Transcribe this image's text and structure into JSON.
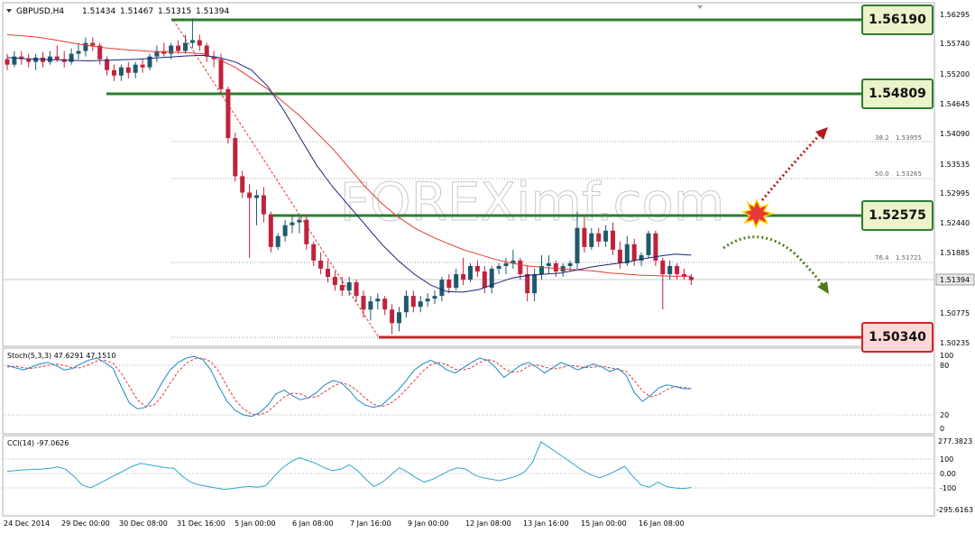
{
  "header": {
    "symbol": "GBPUSD,H4",
    "open": "1.51434",
    "high": "1.51467",
    "low": "1.51315",
    "close": "1.51394"
  },
  "watermark": "FOREXimf.com",
  "colors": {
    "background": "#ffffff",
    "bull_candle": "#1f5a6b",
    "bear_candle": "#c0223b",
    "ma_fast": "#1a237e",
    "ma_slow": "#e53935",
    "support_line": "#2e7d32",
    "target_line": "#c62828",
    "badge_green": "#eaf3c9",
    "badge_red": "#ffd7d7",
    "stoch_main": "#1e88c8",
    "stoch_signal": "#e53935",
    "cci": "#2aa7c8"
  },
  "levels": [
    {
      "value": "1.56190",
      "role": "resistance"
    },
    {
      "value": "1.54809",
      "role": "resistance"
    },
    {
      "value": "1.52575",
      "role": "resistance"
    },
    {
      "value": "1.50340",
      "role": "support"
    }
  ],
  "fibonacci": [
    {
      "ratio": "38.2",
      "price": "1.53955"
    },
    {
      "ratio": "50.0",
      "price": "1.53265"
    },
    {
      "ratio": "76.4",
      "price": "1.51721"
    }
  ],
  "price_axis": {
    "ticks": [
      "1.56295",
      "1.55740",
      "1.55200",
      "1.54645",
      "1.54090",
      "1.53535",
      "1.52995",
      "1.52440",
      "1.51885",
      "1.51394",
      "1.50775",
      "1.50235"
    ],
    "current": "1.51394"
  },
  "time_axis": [
    "24 Dec 2014",
    "29 Dec 00:00",
    "30 Dec 08:00",
    "31 Dec 16:00",
    "5 Jan 00:00",
    "6 Jan 08:00",
    "7 Jan 16:00",
    "9 Jan 00:00",
    "12 Jan 08:00",
    "13 Jan 16:00",
    "15 Jan 00:00",
    "16 Jan 08:00"
  ],
  "stochastic": {
    "label": "Stoch(5,3,3) 47.6291 47.1510",
    "ticks": [
      "100",
      "80",
      "20",
      "0"
    ]
  },
  "cci": {
    "label": "CCI(14) -97.0626",
    "ticks": [
      "277.3823",
      "100",
      "0.00",
      "-100",
      "-295.6163"
    ]
  },
  "chart_data": {
    "type": "candlestick",
    "symbol": "GBPUSD",
    "timeframe": "H4",
    "ylim": [
      1.501,
      1.564
    ],
    "candles": [
      [
        1.5545,
        1.5555,
        1.5525,
        1.5535
      ],
      [
        1.5535,
        1.556,
        1.553,
        1.555
      ],
      [
        1.555,
        1.556,
        1.5535,
        1.5545
      ],
      [
        1.5545,
        1.5555,
        1.553,
        1.554
      ],
      [
        1.554,
        1.5555,
        1.5525,
        1.5548
      ],
      [
        1.5548,
        1.5558,
        1.553,
        1.554
      ],
      [
        1.554,
        1.556,
        1.5535,
        1.555
      ],
      [
        1.555,
        1.557,
        1.554,
        1.5545
      ],
      [
        1.5545,
        1.556,
        1.553,
        1.554
      ],
      [
        1.554,
        1.5565,
        1.5535,
        1.5555
      ],
      [
        1.5555,
        1.5575,
        1.5545,
        1.556
      ],
      [
        1.556,
        1.5585,
        1.555,
        1.5575
      ],
      [
        1.5575,
        1.5585,
        1.556,
        1.557
      ],
      [
        1.557,
        1.5575,
        1.5535,
        1.5545
      ],
      [
        1.5545,
        1.555,
        1.5515,
        1.5525
      ],
      [
        1.5525,
        1.5535,
        1.5505,
        1.5515
      ],
      [
        1.5515,
        1.5535,
        1.5505,
        1.553
      ],
      [
        1.553,
        1.554,
        1.551,
        1.552
      ],
      [
        1.552,
        1.554,
        1.551,
        1.5535
      ],
      [
        1.5535,
        1.5545,
        1.552,
        1.553
      ],
      [
        1.553,
        1.5555,
        1.5525,
        1.555
      ],
      [
        1.555,
        1.557,
        1.554,
        1.556
      ],
      [
        1.556,
        1.5575,
        1.555,
        1.5555
      ],
      [
        1.5555,
        1.5575,
        1.5545,
        1.557
      ],
      [
        1.557,
        1.558,
        1.5555,
        1.556
      ],
      [
        1.556,
        1.559,
        1.5555,
        1.5575
      ],
      [
        1.5575,
        1.562,
        1.5565,
        1.558
      ],
      [
        1.558,
        1.559,
        1.556,
        1.557
      ],
      [
        1.557,
        1.5575,
        1.554,
        1.555
      ],
      [
        1.555,
        1.556,
        1.553,
        1.5545
      ],
      [
        1.5545,
        1.5555,
        1.548,
        1.549
      ],
      [
        1.549,
        1.5495,
        1.539,
        1.54
      ],
      [
        1.54,
        1.541,
        1.532,
        1.533
      ],
      [
        1.533,
        1.534,
        1.529,
        1.53
      ],
      [
        1.53,
        1.5315,
        1.518,
        1.529
      ],
      [
        1.529,
        1.5305,
        1.524,
        1.5295
      ],
      [
        1.5295,
        1.531,
        1.5245,
        1.526
      ],
      [
        1.526,
        1.5265,
        1.519,
        1.52
      ],
      [
        1.52,
        1.5225,
        1.5195,
        1.522
      ],
      [
        1.522,
        1.525,
        1.521,
        1.524
      ],
      [
        1.524,
        1.526,
        1.5225,
        1.5245
      ],
      [
        1.5245,
        1.5255,
        1.5225,
        1.525
      ],
      [
        1.525,
        1.526,
        1.5195,
        1.5205
      ],
      [
        1.5205,
        1.521,
        1.5165,
        1.5175
      ],
      [
        1.5175,
        1.519,
        1.515,
        1.516
      ],
      [
        1.516,
        1.5175,
        1.5135,
        1.5145
      ],
      [
        1.5145,
        1.5155,
        1.512,
        1.513
      ],
      [
        1.513,
        1.5145,
        1.511,
        1.512
      ],
      [
        1.512,
        1.5145,
        1.511,
        1.5135
      ],
      [
        1.5135,
        1.514,
        1.51,
        1.511
      ],
      [
        1.511,
        1.512,
        1.507,
        1.5085
      ],
      [
        1.5085,
        1.511,
        1.5065,
        1.51
      ],
      [
        1.51,
        1.5115,
        1.5085,
        1.5105
      ],
      [
        1.5105,
        1.511,
        1.5075,
        1.5085
      ],
      [
        1.5085,
        1.5095,
        1.504,
        1.506
      ],
      [
        1.506,
        1.509,
        1.5045,
        1.508
      ],
      [
        1.508,
        1.512,
        1.507,
        1.511
      ],
      [
        1.511,
        1.512,
        1.508,
        1.509
      ],
      [
        1.509,
        1.511,
        1.508,
        1.51
      ],
      [
        1.51,
        1.5115,
        1.509,
        1.5105
      ],
      [
        1.5105,
        1.512,
        1.5095,
        1.511
      ],
      [
        1.511,
        1.5145,
        1.51,
        1.514
      ],
      [
        1.514,
        1.515,
        1.5115,
        1.5125
      ],
      [
        1.5125,
        1.516,
        1.512,
        1.515
      ],
      [
        1.515,
        1.518,
        1.513,
        1.514
      ],
      [
        1.514,
        1.517,
        1.5135,
        1.5165
      ],
      [
        1.5165,
        1.5175,
        1.5145,
        1.5155
      ],
      [
        1.5155,
        1.5165,
        1.5115,
        1.5125
      ],
      [
        1.5125,
        1.5165,
        1.5115,
        1.516
      ],
      [
        1.516,
        1.517,
        1.515,
        1.5165
      ],
      [
        1.5165,
        1.518,
        1.515,
        1.517
      ],
      [
        1.517,
        1.5195,
        1.516,
        1.5175
      ],
      [
        1.5175,
        1.518,
        1.514,
        1.515
      ],
      [
        1.515,
        1.5165,
        1.51,
        1.5115
      ],
      [
        1.5115,
        1.516,
        1.51,
        1.515
      ],
      [
        1.515,
        1.5185,
        1.514,
        1.5165
      ],
      [
        1.5165,
        1.5185,
        1.515,
        1.517
      ],
      [
        1.517,
        1.5175,
        1.5145,
        1.5155
      ],
      [
        1.5155,
        1.517,
        1.5145,
        1.5165
      ],
      [
        1.5165,
        1.5175,
        1.5155,
        1.517
      ],
      [
        1.517,
        1.5265,
        1.516,
        1.5235
      ],
      [
        1.5235,
        1.5255,
        1.519,
        1.52
      ],
      [
        1.52,
        1.5235,
        1.5195,
        1.5225
      ],
      [
        1.5225,
        1.5235,
        1.52,
        1.521
      ],
      [
        1.521,
        1.524,
        1.52,
        1.523
      ],
      [
        1.523,
        1.5245,
        1.5185,
        1.5195
      ],
      [
        1.5195,
        1.521,
        1.516,
        1.517
      ],
      [
        1.517,
        1.522,
        1.5165,
        1.5205
      ],
      [
        1.5205,
        1.5215,
        1.5165,
        1.5175
      ],
      [
        1.5175,
        1.519,
        1.5165,
        1.5185
      ],
      [
        1.5185,
        1.523,
        1.518,
        1.5225
      ],
      [
        1.5225,
        1.523,
        1.5165,
        1.5175
      ],
      [
        1.5175,
        1.518,
        1.5085,
        1.515
      ],
      [
        1.515,
        1.5175,
        1.514,
        1.5165
      ],
      [
        1.5165,
        1.517,
        1.514,
        1.515
      ],
      [
        1.515,
        1.516,
        1.514,
        1.5145
      ],
      [
        1.5145,
        1.515,
        1.513,
        1.5139
      ]
    ],
    "ma_fast": [
      1.5548,
      1.5546,
      1.5545,
      1.5544,
      1.5543,
      1.5542,
      1.5543,
      1.5544,
      1.5545,
      1.5547,
      1.5549,
      1.5551,
      1.5552,
      1.5548,
      1.554,
      1.5525,
      1.5495,
      1.545,
      1.54,
      1.535,
      1.531,
      1.5275,
      1.524,
      1.5205,
      1.5175,
      1.515,
      1.513,
      1.5118,
      1.5117,
      1.5122,
      1.5133,
      1.5143,
      1.5148,
      1.515,
      1.5152,
      1.5158,
      1.5164,
      1.5168,
      1.5172,
      1.5178,
      1.5183,
      1.5187,
      1.5185
    ],
    "ma_slow": [
      1.559,
      1.5588,
      1.5585,
      1.558,
      1.5575,
      1.557,
      1.5566,
      1.5563,
      1.5561,
      1.5559,
      1.5558,
      1.5557,
      1.5555,
      1.5545,
      1.553,
      1.551,
      1.549,
      1.5465,
      1.544,
      1.541,
      1.538,
      1.5345,
      1.531,
      1.528,
      1.5255,
      1.5235,
      1.522,
      1.5207,
      1.5195,
      1.5186,
      1.5177,
      1.517,
      1.5165,
      1.5162,
      1.516,
      1.5158,
      1.5156,
      1.5152,
      1.515,
      1.5148,
      1.5147,
      1.5146,
      1.5146
    ],
    "stoch_main": [
      78,
      75,
      72,
      76,
      80,
      82,
      78,
      72,
      74,
      80,
      85,
      88,
      82,
      74,
      50,
      28,
      20,
      22,
      35,
      55,
      72,
      82,
      88,
      90,
      86,
      72,
      50,
      30,
      18,
      12,
      10,
      15,
      25,
      40,
      45,
      38,
      32,
      35,
      42,
      52,
      58,
      55,
      45,
      32,
      25,
      22,
      25,
      35,
      45,
      58,
      72,
      80,
      85,
      80,
      72,
      68,
      75,
      82,
      88,
      85,
      75,
      62,
      70,
      78,
      82,
      76,
      68,
      75,
      82,
      78,
      72,
      76,
      80,
      76,
      70,
      74,
      65,
      42,
      30,
      38,
      48,
      52,
      50,
      47,
      47
    ],
    "stoch_signal": [
      76,
      77,
      75,
      74,
      76,
      78,
      80,
      78,
      75,
      75,
      79,
      84,
      85,
      81,
      68,
      50,
      32,
      23,
      25,
      37,
      54,
      70,
      81,
      87,
      88,
      83,
      70,
      50,
      32,
      20,
      13,
      12,
      16,
      26,
      36,
      41,
      40,
      35,
      36,
      43,
      50,
      55,
      52,
      44,
      34,
      26,
      23,
      27,
      35,
      46,
      58,
      70,
      79,
      82,
      79,
      73,
      72,
      75,
      82,
      86,
      83,
      74,
      69,
      70,
      77,
      79,
      76,
      73,
      75,
      78,
      77,
      75,
      76,
      77,
      75,
      73,
      70,
      58,
      44,
      36,
      39,
      46,
      50,
      49,
      47
    ],
    "cci": [
      15,
      20,
      25,
      28,
      30,
      35,
      45,
      30,
      -20,
      -80,
      -100,
      -70,
      -40,
      -10,
      20,
      50,
      70,
      60,
      50,
      40,
      35,
      -20,
      -60,
      -80,
      -90,
      -100,
      -110,
      -105,
      -95,
      -90,
      -95,
      -85,
      -20,
      40,
      80,
      110,
      90,
      70,
      40,
      20,
      30,
      60,
      20,
      -40,
      -90,
      -60,
      -10,
      40,
      10,
      -30,
      -60,
      -40,
      -10,
      20,
      40,
      30,
      -10,
      -30,
      -40,
      -50,
      -35,
      -20,
      10,
      80,
      220,
      180,
      140,
      100,
      60,
      20,
      -10,
      -30,
      -10,
      20,
      50,
      -20,
      -80,
      -95,
      -60,
      -90,
      -100,
      -105,
      -97
    ]
  }
}
